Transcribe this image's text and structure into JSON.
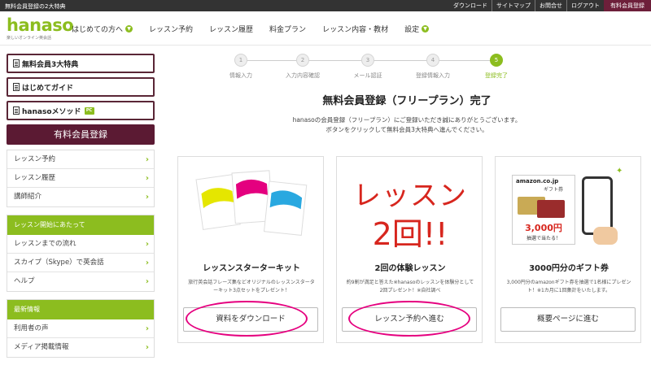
{
  "topbar": {
    "tagline": "無料会員登録の2大特典",
    "links": [
      "ダウンロード",
      "サイトマップ",
      "お問合せ",
      "ログアウト"
    ],
    "register": "有料会員登録"
  },
  "logo": {
    "word": "hanaso",
    "tagline": "楽しいオンライン英会話"
  },
  "nav": [
    {
      "label": "はじめての方へ",
      "chevron": true
    },
    {
      "label": "レッスン予約",
      "chevron": false
    },
    {
      "label": "レッスン履歴",
      "chevron": false
    },
    {
      "label": "料金プラン",
      "chevron": false
    },
    {
      "label": "レッスン内容・教材",
      "chevron": false
    },
    {
      "label": "設定",
      "chevron": true
    }
  ],
  "sidebar": {
    "buttons": [
      "無料会員3大特典",
      "はじめてガイド",
      "hanasoメソッド"
    ],
    "pc_badge": "PC",
    "register": "有料会員登録",
    "group1": [
      "レッスン予約",
      "レッスン履歴",
      "講師紹介"
    ],
    "group2": {
      "head": "レッスン開始にあたって",
      "rows": [
        "レッスンまでの流れ",
        "スカイプ（Skype）で英会話",
        "ヘルプ"
      ]
    },
    "group3": {
      "head": "最新情報",
      "rows": [
        "利用者の声",
        "メディア掲載情報"
      ]
    }
  },
  "steps": [
    {
      "num": "1",
      "label": "情報入力"
    },
    {
      "num": "2",
      "label": "入力内容確認"
    },
    {
      "num": "3",
      "label": "メール認証"
    },
    {
      "num": "4",
      "label": "登録情報入力"
    },
    {
      "num": "5",
      "label": "登録完了"
    }
  ],
  "main": {
    "title": "無料会員登録（フリープラン）完了",
    "intro1": "hanasoの会員登録（フリープラン）にご登録いただき誠にありがとうございます。",
    "intro2": "ボタンをクリックして無料会員3大特典へ進んでください。"
  },
  "cards": [
    {
      "title": "レッスンスターターキット",
      "desc": "旅行英会話フレーズ集などオリジナルのレッスンスターターキット3点セットをプレゼント！",
      "button": "資料をダウンロード"
    },
    {
      "title": "2回の体験レッスン",
      "desc": "約9割が満足と答えた※hanasoのレッスンを体験分として2回プレゼント！※自社調べ",
      "button": "レッスン予約へ進む",
      "img_line1": "レッスン",
      "img_line2": "2回!!"
    },
    {
      "title": "3000円分のギフト券",
      "desc": "3,000円分のamazonギフト券を抽選で1名様にプレゼント！※1カ月に1回集計をいたします。",
      "button": "概要ページに進む",
      "amazon": "amazon.co.jp",
      "gift": "ギフト券",
      "amount": "3,000円",
      "lottery": "抽選で当たる！"
    }
  ],
  "colors": {
    "accent": "#8cbd1f",
    "brand": "#5b1a33",
    "highlight": "#e5007f"
  }
}
